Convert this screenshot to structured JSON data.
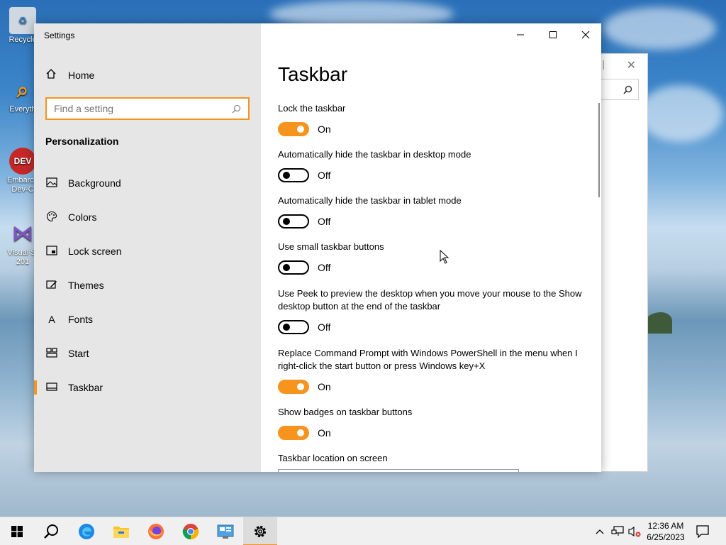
{
  "desktop": {
    "icons": [
      {
        "label": "Recycle",
        "icon": "recycle-bin-icon"
      },
      {
        "label": "Everyth",
        "icon": "everything-search-icon"
      },
      {
        "label": "Embarca Dev-C",
        "icon": "devcpp-icon"
      },
      {
        "label": "Visual St 201",
        "icon": "visual-studio-icon"
      }
    ]
  },
  "settings_window": {
    "title": "Settings",
    "home_label": "Home",
    "search_placeholder": "Find a setting",
    "section_heading": "Personalization",
    "nav_items": [
      {
        "label": "Background",
        "icon": "image-icon"
      },
      {
        "label": "Colors",
        "icon": "palette-icon"
      },
      {
        "label": "Lock screen",
        "icon": "lock-screen-icon"
      },
      {
        "label": "Themes",
        "icon": "themes-icon"
      },
      {
        "label": "Fonts",
        "icon": "fonts-icon"
      },
      {
        "label": "Start",
        "icon": "start-icon"
      },
      {
        "label": "Taskbar",
        "icon": "taskbar-icon"
      }
    ],
    "active_nav": "Taskbar"
  },
  "content": {
    "page_title": "Taskbar",
    "settings": [
      {
        "label": "Lock the taskbar",
        "on": true,
        "state": "On"
      },
      {
        "label": "Automatically hide the taskbar in desktop mode",
        "on": false,
        "state": "Off"
      },
      {
        "label": "Automatically hide the taskbar in tablet mode",
        "on": false,
        "state": "Off"
      },
      {
        "label": "Use small taskbar buttons",
        "on": false,
        "state": "Off"
      },
      {
        "label": "Use Peek to preview the desktop when you move your mouse to the Show desktop button at the end of the taskbar",
        "on": false,
        "state": "Off"
      },
      {
        "label": "Replace Command Prompt with Windows PowerShell in the menu when I right-click the start button or press Windows key+X",
        "on": true,
        "state": "On"
      },
      {
        "label": "Show badges on taskbar buttons",
        "on": true,
        "state": "On"
      }
    ],
    "location_label": "Taskbar location on screen"
  },
  "taskbar": {
    "apps": [
      {
        "name": "start-button",
        "icon": "windows-logo-icon"
      },
      {
        "name": "search-button",
        "icon": "search-icon"
      },
      {
        "name": "edge-button",
        "icon": "edge-icon"
      },
      {
        "name": "file-explorer-button",
        "icon": "folder-icon"
      },
      {
        "name": "firefox-button",
        "icon": "firefox-icon"
      },
      {
        "name": "chrome-button",
        "icon": "chrome-icon"
      },
      {
        "name": "control-panel-button",
        "icon": "control-panel-icon"
      },
      {
        "name": "settings-button",
        "icon": "gear-icon"
      }
    ],
    "time": "12:36 AM",
    "date": "6/25/2023"
  },
  "colors": {
    "accent": "#f7941d",
    "sidebar_bg": "#e6e6e6",
    "taskbar_bg": "#f0f0f0"
  }
}
